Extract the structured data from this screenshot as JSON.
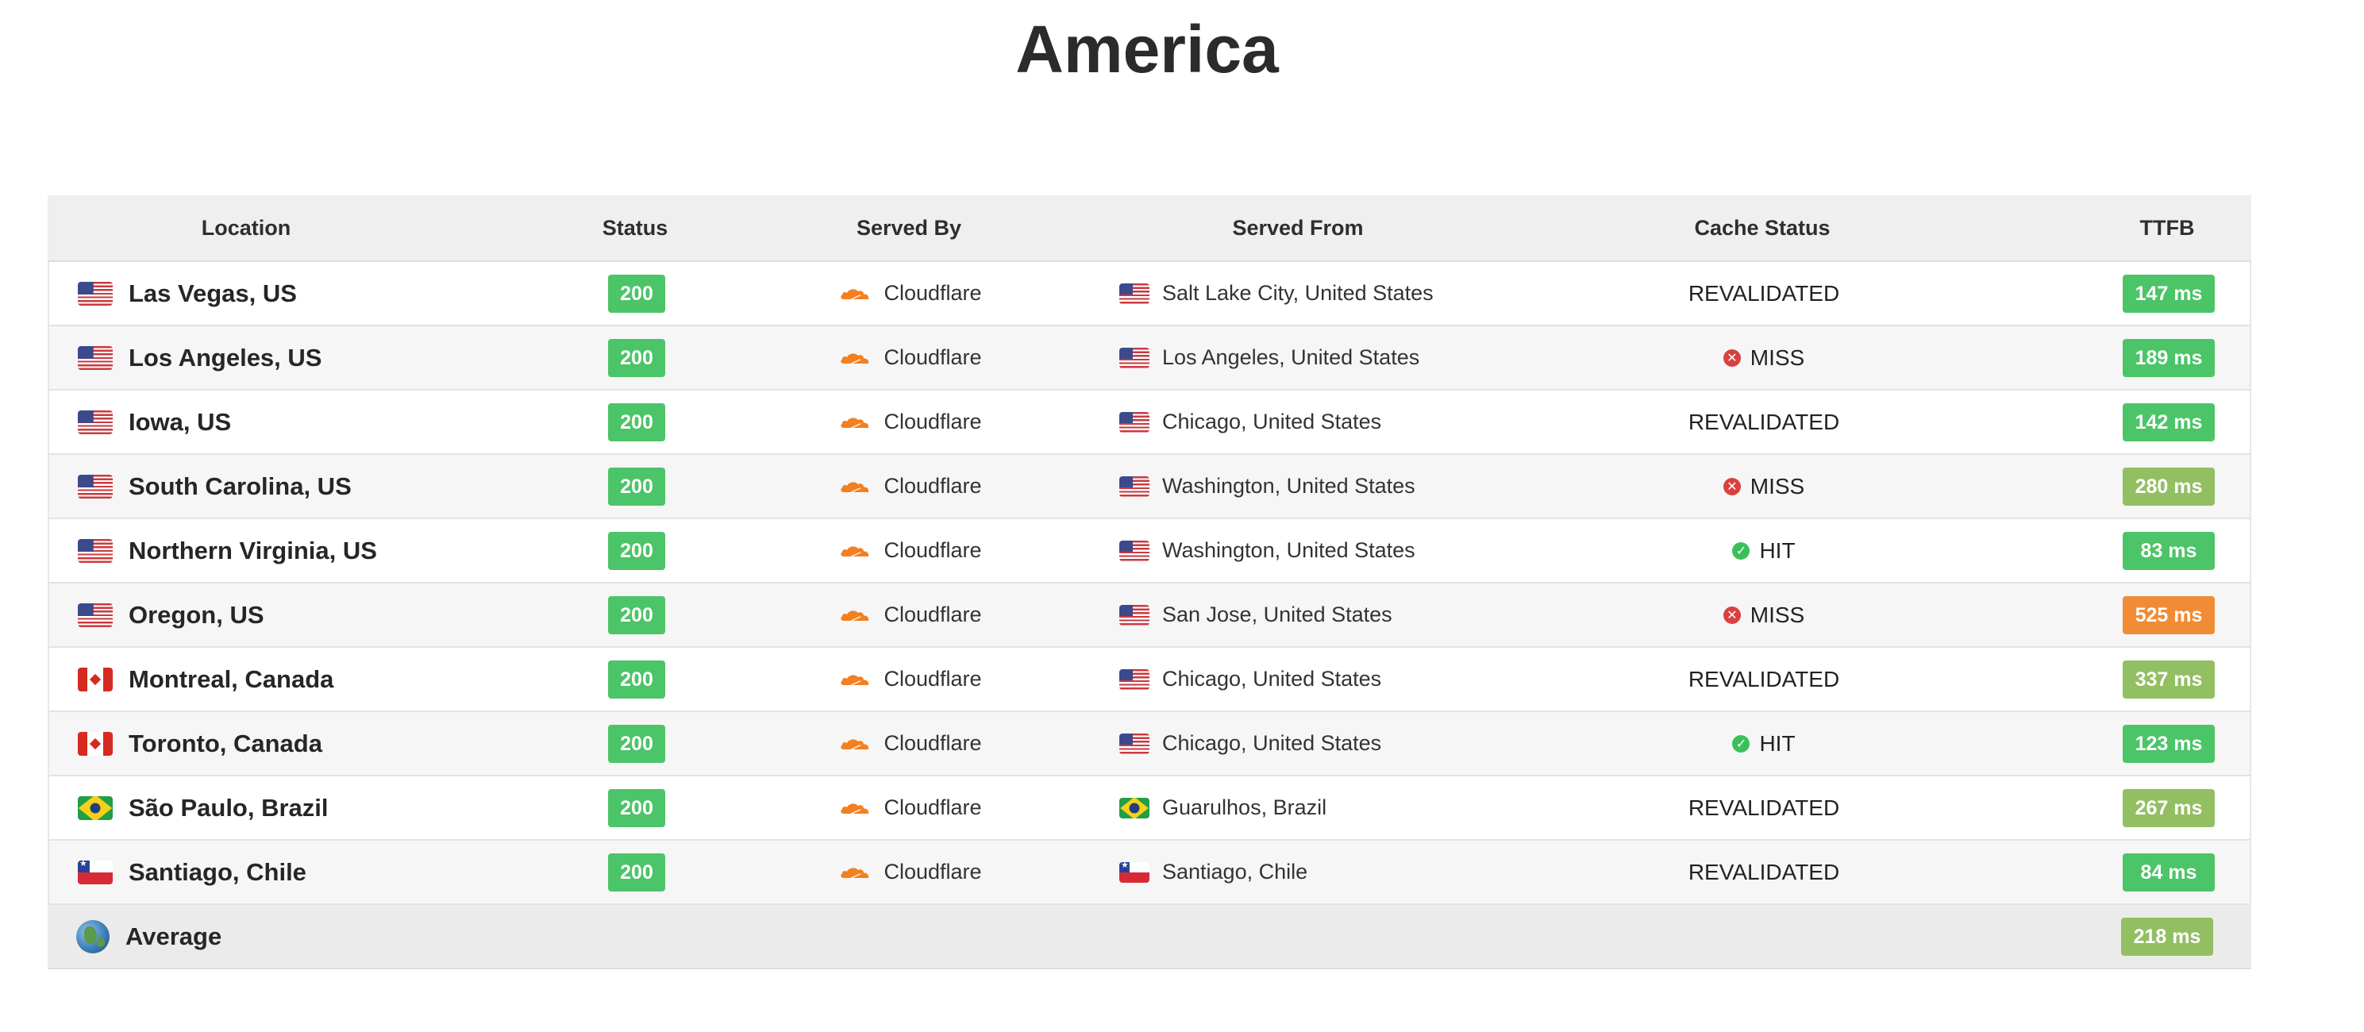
{
  "page": {
    "title": "America"
  },
  "table": {
    "headers": {
      "location": "Location",
      "status": "Status",
      "served_by": "Served By",
      "served_from": "Served From",
      "cache_status": "Cache Status",
      "ttfb": "TTFB"
    },
    "rows": [
      {
        "flag": "us",
        "location": "Las Vegas, US",
        "status": "200",
        "served_by": "Cloudflare",
        "from_flag": "us",
        "served_from": "Salt Lake City, United States",
        "cache_icon": "",
        "cache": "REVALIDATED",
        "ttfb": "147 ms",
        "ttfb_color": "#4cc468"
      },
      {
        "flag": "us",
        "location": "Los Angeles, US",
        "status": "200",
        "served_by": "Cloudflare",
        "from_flag": "us",
        "served_from": "Los Angeles, United States",
        "cache_icon": "miss",
        "cache": "MISS",
        "ttfb": "189 ms",
        "ttfb_color": "#4cc468"
      },
      {
        "flag": "us",
        "location": "Iowa, US",
        "status": "200",
        "served_by": "Cloudflare",
        "from_flag": "us",
        "served_from": "Chicago, United States",
        "cache_icon": "",
        "cache": "REVALIDATED",
        "ttfb": "142 ms",
        "ttfb_color": "#4cc468"
      },
      {
        "flag": "us",
        "location": "South Carolina, US",
        "status": "200",
        "served_by": "Cloudflare",
        "from_flag": "us",
        "served_from": "Washington, United States",
        "cache_icon": "miss",
        "cache": "MISS",
        "ttfb": "280 ms",
        "ttfb_color": "#93bf63"
      },
      {
        "flag": "us",
        "location": "Northern Virginia, US",
        "status": "200",
        "served_by": "Cloudflare",
        "from_flag": "us",
        "served_from": "Washington, United States",
        "cache_icon": "hit",
        "cache": "HIT",
        "ttfb": "83 ms",
        "ttfb_color": "#4cc468"
      },
      {
        "flag": "us",
        "location": "Oregon, US",
        "status": "200",
        "served_by": "Cloudflare",
        "from_flag": "us",
        "served_from": "San Jose, United States",
        "cache_icon": "miss",
        "cache": "MISS",
        "ttfb": "525 ms",
        "ttfb_color": "#f08c36"
      },
      {
        "flag": "ca",
        "location": "Montreal, Canada",
        "status": "200",
        "served_by": "Cloudflare",
        "from_flag": "us",
        "served_from": "Chicago, United States",
        "cache_icon": "",
        "cache": "REVALIDATED",
        "ttfb": "337 ms",
        "ttfb_color": "#93bf63"
      },
      {
        "flag": "ca",
        "location": "Toronto, Canada",
        "status": "200",
        "served_by": "Cloudflare",
        "from_flag": "us",
        "served_from": "Chicago, United States",
        "cache_icon": "hit",
        "cache": "HIT",
        "ttfb": "123 ms",
        "ttfb_color": "#4cc468"
      },
      {
        "flag": "br",
        "location": "São Paulo, Brazil",
        "status": "200",
        "served_by": "Cloudflare",
        "from_flag": "br",
        "served_from": "Guarulhos, Brazil",
        "cache_icon": "",
        "cache": "REVALIDATED",
        "ttfb": "267 ms",
        "ttfb_color": "#93bf63"
      },
      {
        "flag": "cl",
        "location": "Santiago, Chile",
        "status": "200",
        "served_by": "Cloudflare",
        "from_flag": "cl",
        "served_from": "Santiago, Chile",
        "cache_icon": "",
        "cache": "REVALIDATED",
        "ttfb": "84 ms",
        "ttfb_color": "#4cc468"
      }
    ],
    "average": {
      "icon": "globe-icon",
      "label": "Average",
      "ttfb": "218 ms",
      "ttfb_color": "#93bf63"
    }
  },
  "colors": {
    "status_ok": "#4cc468",
    "cloudflare_orange": "#f38020",
    "cache_miss": "#d94141",
    "cache_hit": "#3cbf5a"
  }
}
